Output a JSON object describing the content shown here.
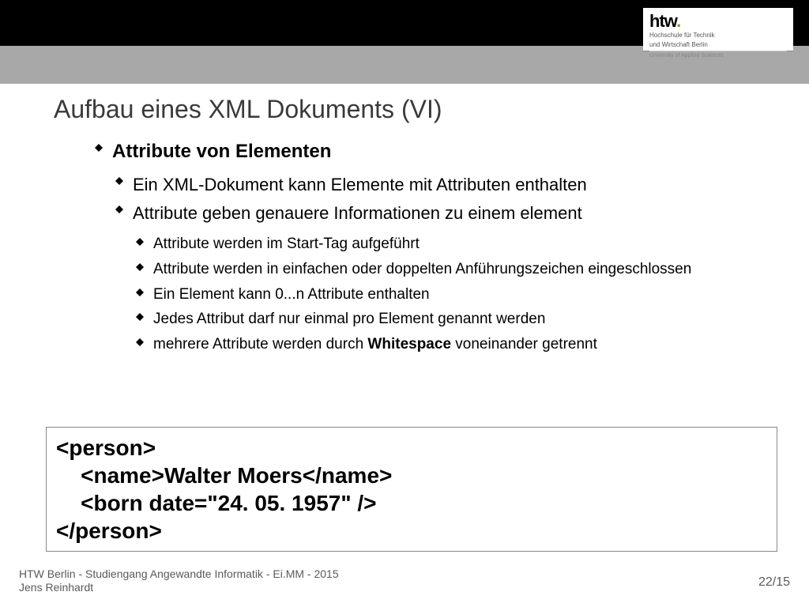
{
  "logo": {
    "name": "htw.",
    "sub1": "Hochschule für Technik",
    "sub2": "und Wirtschaft Berlin",
    "sub3": "University of Applied Sciences"
  },
  "title": "Aufbau eines XML Dokuments (VI)",
  "bullets": {
    "l1": "Attribute von Elementen",
    "l2a": "Ein XML-Dokument kann Elemente mit Attributen enthalten",
    "l2b": "Attribute geben genauere Informationen zu einem element",
    "l3a": "Attribute werden im Start-Tag aufgeführt",
    "l3b": "Attribute werden in einfachen oder doppelten Anführungszeichen eingeschlossen",
    "l3c": "Ein Element kann 0...n Attribute enthalten",
    "l3d": "Jedes Attribut darf nur einmal pro Element genannt werden",
    "l3e_pre": "mehrere Attribute werden durch ",
    "l3e_bold": "Whitespace",
    "l3e_post": " voneinander getrennt"
  },
  "code": {
    "line1": "<person>",
    "line2": "    <name>Walter Moers</name>",
    "line3": "    <born date=\"24. 05. 1957\" />",
    "line4": "</person>"
  },
  "footer": {
    "line1": "HTW Berlin - Studiengang Angewandte Informatik - Ei.MM - 2015",
    "line2": "Jens Reinhardt",
    "page": "22/15"
  }
}
